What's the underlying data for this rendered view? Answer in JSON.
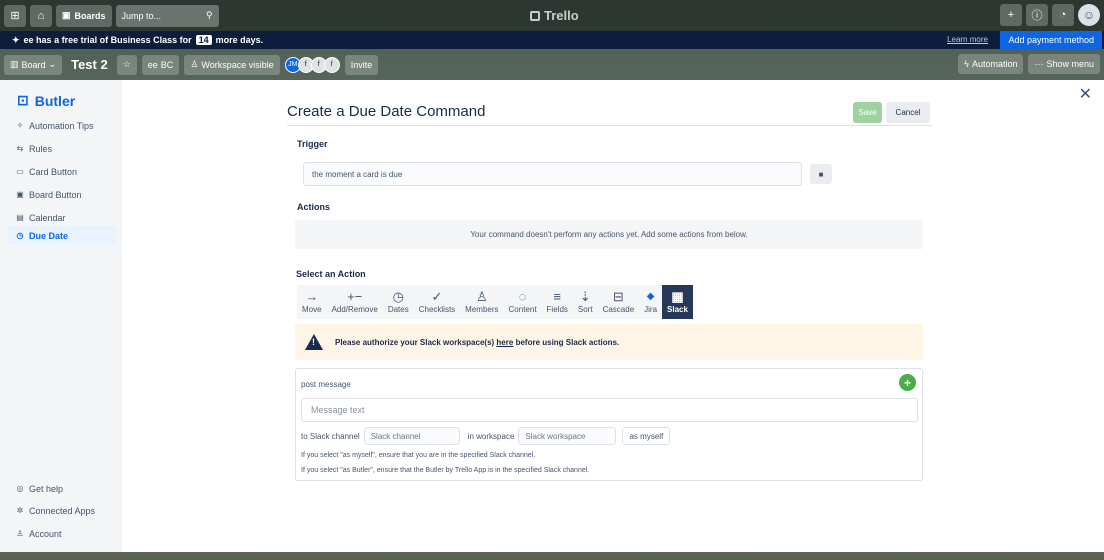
{
  "topnav": {
    "boards_label": "Boards",
    "search_placeholder": "Jump to...",
    "app_name": "Trello",
    "create_label": "+",
    "info_label": "ⓘ",
    "bell_label": "♫",
    "avatar_label": "☺"
  },
  "banner": {
    "text_before": "ee has a free trial of Business Class for",
    "days": "14",
    "text_after": "more days.",
    "learn_more": "Learn more",
    "add_payment": "Add payment method"
  },
  "boardbar": {
    "board_view": "Board",
    "title": "Test 2",
    "workspace": "ee",
    "workspace_badge": "BC",
    "visibility": "Workspace visible",
    "members": [
      "JM",
      "f",
      "f",
      "f"
    ],
    "invite": "Invite",
    "automation": "Automation",
    "show_menu": "Show menu"
  },
  "sidebar": {
    "title": "Butler",
    "items": [
      {
        "label": "Automation Tips",
        "icon": "✧"
      },
      {
        "label": "Rules",
        "icon": "⇆"
      },
      {
        "label": "Card Button",
        "icon": "▭"
      },
      {
        "label": "Board Button",
        "icon": "▣"
      },
      {
        "label": "Calendar",
        "icon": "▤"
      },
      {
        "label": "Due Date",
        "icon": "◷"
      }
    ],
    "footer": [
      {
        "label": "Get help",
        "icon": "◎"
      },
      {
        "label": "Connected Apps",
        "icon": "✲"
      },
      {
        "label": "Account",
        "icon": "♙"
      }
    ]
  },
  "command": {
    "title": "Create a Due Date Command",
    "save": "Save",
    "cancel": "Cancel",
    "trigger_label": "Trigger",
    "trigger_value": "the moment a card is due",
    "actions_label": "Actions",
    "actions_empty": "Your command doesn't perform any actions yet. Add some actions from below.",
    "select_action_label": "Select an Action",
    "tabs": [
      {
        "label": "Move",
        "icon": "→"
      },
      {
        "label": "Add/Remove",
        "icon": "+−"
      },
      {
        "label": "Dates",
        "icon": "◷"
      },
      {
        "label": "Checklists",
        "icon": "✓"
      },
      {
        "label": "Members",
        "icon": "♙"
      },
      {
        "label": "Content",
        "icon": "◌"
      },
      {
        "label": "Fields",
        "icon": "≡"
      },
      {
        "label": "Sort",
        "icon": "⇣"
      },
      {
        "label": "Cascade",
        "icon": "⊟"
      },
      {
        "label": "Jira",
        "icon": "◆"
      },
      {
        "label": "Slack",
        "icon": "▦"
      }
    ],
    "warning_before": "Please authorize your Slack workspace(s)",
    "warning_link": "here",
    "warning_after": "before using Slack actions.",
    "post_message": "post message",
    "message_placeholder": "Message text",
    "to_channel": "to Slack channel",
    "channel_placeholder": "Slack channel",
    "in_workspace": "in workspace",
    "workspace_placeholder": "Slack workspace",
    "as_myself": "as myself",
    "hint1": "If you select \"as myself\", ensure that you are in the specified Slack channel.",
    "hint2": "If you select \"as Butler\", ensure that the Butler by Trello App is in the specified Slack channel."
  },
  "colors": {
    "accent": "#0c66e4",
    "banner_bg": "#0b1f3d",
    "active_tab": "#253858",
    "save_disabled": "#9fd29f",
    "add_green": "#4bad47",
    "warning_bg": "#fff5e6"
  }
}
